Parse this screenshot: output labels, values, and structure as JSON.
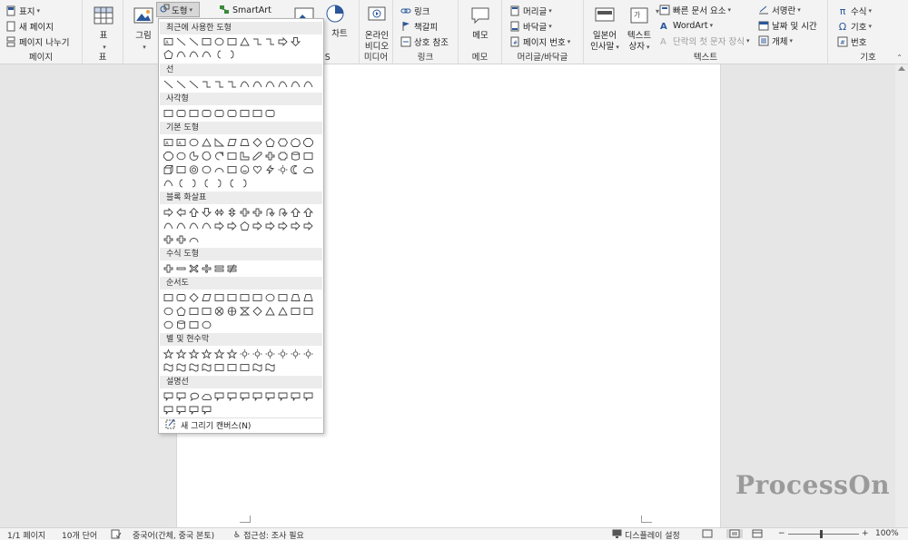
{
  "ribbon": {
    "pages_group": {
      "label": "페이지",
      "items": [
        "표지",
        "새 페이지",
        "페이지 나누기"
      ]
    },
    "table_group": {
      "label": "표",
      "button": "표"
    },
    "illustrations": {
      "picture_label": "그림",
      "shapes_label": "도형",
      "smartart_label": "SmartArt",
      "chart_label": "차트"
    },
    "addins_label_fragment": "LUS",
    "media_group": {
      "label": "미디어",
      "button_line1": "온라인",
      "button_line2": "비디오"
    },
    "links_group": {
      "label": "링크",
      "items": [
        "링크",
        "책갈피",
        "상호 참조"
      ]
    },
    "comments_group": {
      "label": "메모",
      "button": "메모"
    },
    "header_footer_group": {
      "label": "머리글/바닥글",
      "items": [
        "머리글",
        "바닥글",
        "페이지 번호"
      ]
    },
    "text_group": {
      "label": "텍스트",
      "greeting_line1": "일본어",
      "greeting_line2": "인사말",
      "textbox_line1": "텍스트",
      "textbox_line2": "상자",
      "quick_parts": "빠른 문서 요소",
      "wordart": "WordArt",
      "dropcap": "단락의 첫 문자 장식",
      "signature": "서명란",
      "datetime": "날짜 및 시간",
      "object": "개체"
    },
    "symbols_group": {
      "label": "기호",
      "equation": "수식",
      "symbol": "기호",
      "number": "번호"
    }
  },
  "shapes_menu": {
    "sections": [
      "최근에 사용한 도형",
      "선",
      "사각형",
      "기본 도형",
      "블록 화살표",
      "수식 도형",
      "순서도",
      "별 및 현수막",
      "설명선"
    ],
    "new_canvas": "새 그리기 캔버스(N)"
  },
  "watermark": "ProcessOn",
  "status_bar": {
    "page": "1/1 페이지",
    "words": "10개 단어",
    "language": "중국어(간체, 중국 본토)",
    "accessibility": "접근성: 조사 필요",
    "display_settings": "디스플레이 설정",
    "zoom": "100%"
  },
  "colors": {
    "ribbon_bg": "#f3f3f3",
    "accent": "#2b579a",
    "watermark": "#9a9a9a"
  }
}
